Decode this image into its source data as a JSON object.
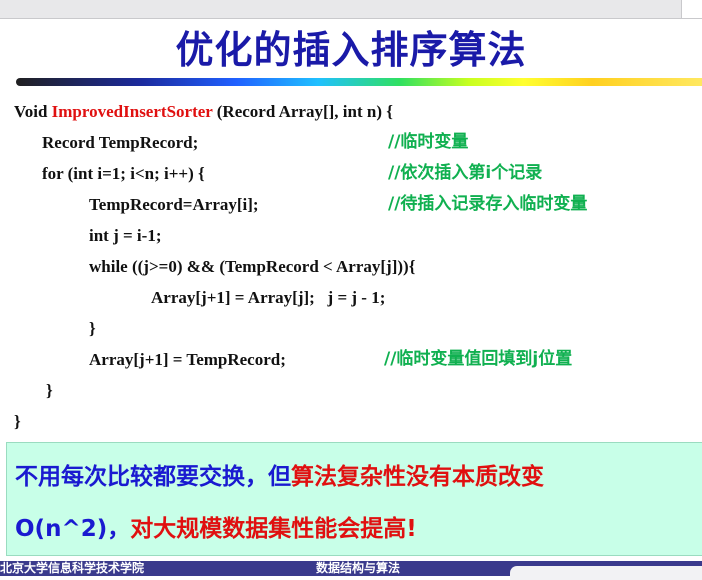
{
  "slide": {
    "title": "优化的插入排序算法"
  },
  "code": {
    "l1_kw": "Void ",
    "l1_fn": "ImprovedInsertSorter",
    "l1_rest": " (Record Array[], int n) {",
    "l2": "Record TempRecord;",
    "l3": "for (int i=1; i<n; i++) {",
    "l4": "TempRecord=Array[i];",
    "l5": "int j = i-1;",
    "l6": "while ((j>=0) && (TempRecord < Array[j])){",
    "l7": "Array[j+1] = Array[j];   j = j - 1;",
    "l8": "}",
    "l9": "Array[j+1] = TempRecord;",
    "l10": "}",
    "l11": "}"
  },
  "comments": {
    "c2": "//临时变量",
    "c3": "//依次插入第i个记录",
    "c4": "//待插入记录存入临时变量",
    "c9": "//临时变量值回填到j位置"
  },
  "note": {
    "line1_blue": "不用每次比较都要交换，但",
    "line1_red": "算法复杂性没有本质改变",
    "line2_blue": "O(n^2)，",
    "line2_red": "对大规模数据集性能会提高!"
  },
  "footer": {
    "left": "北京大学信息科学技术学院",
    "center": "数据结构与算法"
  },
  "colors": {
    "title": "#1a1aa8",
    "function_name": "#e01010",
    "comment": "#10b050",
    "note_bg": "#c8ffe8",
    "footer_bg": "#3a3a8c"
  }
}
